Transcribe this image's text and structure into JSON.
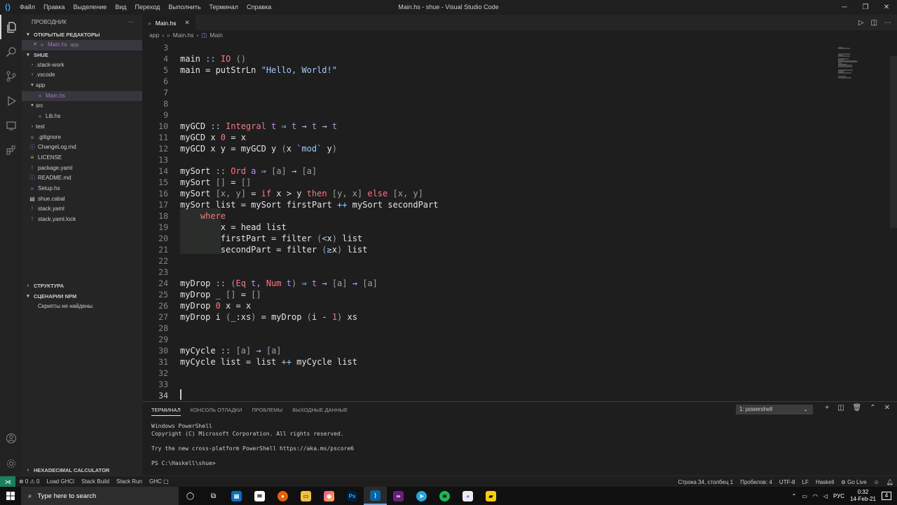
{
  "window": {
    "title": "Main.hs - shue - Visual Studio Code",
    "menu": [
      "Файл",
      "Правка",
      "Выделение",
      "Вид",
      "Переход",
      "Выполнить",
      "Терминал",
      "Справка"
    ]
  },
  "sidebar": {
    "title": "ПРОВОДНИК",
    "more": "···",
    "open_editors_header": "ОТКРЫТЫЕ РЕДАКТОРЫ",
    "open_editor": {
      "name": "Main.hs",
      "path": "app"
    },
    "project_header": "SHUE",
    "tree": [
      {
        "label": ".stack-work",
        "kind": "folder",
        "depth": 1,
        "expanded": false
      },
      {
        "label": ".vscode",
        "kind": "folder",
        "depth": 1,
        "expanded": false
      },
      {
        "label": "app",
        "kind": "folder",
        "depth": 1,
        "expanded": true
      },
      {
        "label": "Main.hs",
        "kind": "hs",
        "depth": 2
      },
      {
        "label": "src",
        "kind": "folder",
        "depth": 1,
        "expanded": true
      },
      {
        "label": "Lib.hs",
        "kind": "hs",
        "depth": 2
      },
      {
        "label": "test",
        "kind": "folder",
        "depth": 1,
        "expanded": false
      },
      {
        "label": ".gitignore",
        "kind": "git",
        "depth": 1
      },
      {
        "label": "ChangeLog.md",
        "kind": "md",
        "depth": 1
      },
      {
        "label": "LICENSE",
        "kind": "lic",
        "depth": 1
      },
      {
        "label": "package.yaml",
        "kind": "yml",
        "depth": 1
      },
      {
        "label": "README.md",
        "kind": "md",
        "depth": 1
      },
      {
        "label": "Setup.hs",
        "kind": "hs",
        "depth": 1
      },
      {
        "label": "shue.cabal",
        "kind": "cabal",
        "depth": 1
      },
      {
        "label": "stack.yaml",
        "kind": "yml",
        "depth": 1
      },
      {
        "label": "stack.yaml.lock",
        "kind": "yml",
        "depth": 1
      }
    ],
    "outline_header": "СТРУКТУРА",
    "npm_header": "СЦЕНАРИИ NPM",
    "npm_empty": "Скрипты не найдены.",
    "hex_header": "HEXADECIMAL CALCULATOR"
  },
  "tab": {
    "label": "Main.hs",
    "close": "✕"
  },
  "breadcrumb": [
    "app",
    "Main.hs",
    "Main"
  ],
  "editor": {
    "cursor_line": 34,
    "lines": [
      {
        "n": "3",
        "tokens": []
      },
      {
        "n": "4",
        "tokens": [
          [
            "fn",
            "main"
          ],
          [
            "opg",
            " :: "
          ],
          [
            "ty",
            "IO"
          ],
          [
            "brk",
            " ()"
          ]
        ]
      },
      {
        "n": "5",
        "tokens": [
          [
            "fn",
            "main = putStrLn "
          ],
          [
            "str",
            "\"Hello, World!\""
          ]
        ]
      },
      {
        "n": "6",
        "tokens": []
      },
      {
        "n": "7",
        "tokens": []
      },
      {
        "n": "8",
        "tokens": []
      },
      {
        "n": "9",
        "tokens": []
      },
      {
        "n": "10",
        "tokens": [
          [
            "fn",
            "myGCD"
          ],
          [
            "opg",
            " :: "
          ],
          [
            "ty",
            "Integral"
          ],
          [
            "tv",
            " t "
          ],
          [
            "opg",
            "⇒"
          ],
          [
            "tv",
            " t "
          ],
          [
            "opg",
            "→"
          ],
          [
            "tv",
            " t "
          ],
          [
            "opg",
            "→"
          ],
          [
            "tv",
            " t"
          ]
        ]
      },
      {
        "n": "11",
        "tokens": [
          [
            "fn",
            "myGCD x "
          ],
          [
            "num",
            "0"
          ],
          [
            "fn",
            " = x"
          ]
        ]
      },
      {
        "n": "12",
        "tokens": [
          [
            "fn",
            "myGCD x y = myGCD y "
          ],
          [
            "brk",
            "("
          ],
          [
            "fn",
            "x "
          ],
          [
            "str",
            "`mod`"
          ],
          [
            "fn",
            " y"
          ],
          [
            "brk",
            ")"
          ]
        ]
      },
      {
        "n": "13",
        "tokens": []
      },
      {
        "n": "14",
        "tokens": [
          [
            "fn",
            "mySort"
          ],
          [
            "opg",
            " :: "
          ],
          [
            "ty",
            "Ord"
          ],
          [
            "tv",
            " a "
          ],
          [
            "opg",
            "⇒"
          ],
          [
            "brk",
            " [a] "
          ],
          [
            "opg",
            "→"
          ],
          [
            "brk",
            " [a]"
          ]
        ]
      },
      {
        "n": "15",
        "tokens": [
          [
            "fn",
            "mySort "
          ],
          [
            "brk",
            "[]"
          ],
          [
            "fn",
            " = "
          ],
          [
            "brk",
            "[]"
          ]
        ]
      },
      {
        "n": "16",
        "tokens": [
          [
            "fn",
            "mySort "
          ],
          [
            "brk",
            "[x, y]"
          ],
          [
            "fn",
            " = "
          ],
          [
            "kw",
            "if"
          ],
          [
            "fn",
            " x > y "
          ],
          [
            "kw",
            "then"
          ],
          [
            "brk",
            " [y, x] "
          ],
          [
            "kw",
            "else"
          ],
          [
            "brk",
            " [x, y]"
          ]
        ]
      },
      {
        "n": "17",
        "tokens": [
          [
            "fn",
            "mySort list = mySort firstPart "
          ],
          [
            "opg",
            "++"
          ],
          [
            "fn",
            " mySort secondPart"
          ]
        ]
      },
      {
        "n": "18",
        "tokens": [
          [
            "fn",
            "    "
          ],
          [
            "kw",
            "where"
          ]
        ]
      },
      {
        "n": "19",
        "tokens": [
          [
            "fn",
            "        x = head list"
          ]
        ]
      },
      {
        "n": "20",
        "tokens": [
          [
            "fn",
            "        firstPart = filter "
          ],
          [
            "brk",
            "("
          ],
          [
            "opg",
            "<"
          ],
          [
            "fn",
            "x"
          ],
          [
            "brk",
            ")"
          ],
          [
            "fn",
            " list"
          ]
        ]
      },
      {
        "n": "21",
        "tokens": [
          [
            "fn",
            "        secondPart = filter "
          ],
          [
            "brk",
            "("
          ],
          [
            "opg",
            "≥"
          ],
          [
            "fn",
            "x"
          ],
          [
            "brk",
            ")"
          ],
          [
            "fn",
            " list"
          ]
        ]
      },
      {
        "n": "22",
        "tokens": []
      },
      {
        "n": "23",
        "tokens": []
      },
      {
        "n": "24",
        "tokens": [
          [
            "fn",
            "myDrop"
          ],
          [
            "opg",
            " :: "
          ],
          [
            "brk",
            "("
          ],
          [
            "ty",
            "Eq"
          ],
          [
            "tv",
            " t, "
          ],
          [
            "ty",
            "Num"
          ],
          [
            "tv",
            " t"
          ],
          [
            "brk",
            ")"
          ],
          [
            "opg",
            " ⇒"
          ],
          [
            "tv",
            " t "
          ],
          [
            "opg",
            "→"
          ],
          [
            "brk",
            " [a] "
          ],
          [
            "opg",
            "→"
          ],
          [
            "brk",
            " [a]"
          ]
        ]
      },
      {
        "n": "25",
        "tokens": [
          [
            "fn",
            "myDrop _ "
          ],
          [
            "brk",
            "[]"
          ],
          [
            "fn",
            " = "
          ],
          [
            "brk",
            "[]"
          ]
        ]
      },
      {
        "n": "26",
        "tokens": [
          [
            "fn",
            "myDrop "
          ],
          [
            "num",
            "0"
          ],
          [
            "fn",
            " x = x"
          ]
        ]
      },
      {
        "n": "27",
        "tokens": [
          [
            "fn",
            "myDrop i "
          ],
          [
            "brk",
            "("
          ],
          [
            "fn",
            "_:xs"
          ],
          [
            "brk",
            ")"
          ],
          [
            "fn",
            " = myDrop "
          ],
          [
            "brk",
            "("
          ],
          [
            "fn",
            "i - "
          ],
          [
            "num",
            "1"
          ],
          [
            "brk",
            ")"
          ],
          [
            "fn",
            " xs"
          ]
        ]
      },
      {
        "n": "28",
        "tokens": []
      },
      {
        "n": "29",
        "tokens": []
      },
      {
        "n": "30",
        "tokens": [
          [
            "fn",
            "myCycle"
          ],
          [
            "opg",
            " :: "
          ],
          [
            "brk",
            "[a] "
          ],
          [
            "opg",
            "→"
          ],
          [
            "brk",
            " [a]"
          ]
        ]
      },
      {
        "n": "31",
        "tokens": [
          [
            "fn",
            "myCycle list = list "
          ],
          [
            "opg",
            "++"
          ],
          [
            "fn",
            " myCycle list"
          ]
        ]
      },
      {
        "n": "32",
        "tokens": []
      },
      {
        "n": "33",
        "tokens": []
      },
      {
        "n": "34",
        "tokens": []
      }
    ]
  },
  "panel": {
    "tabs": [
      "ТЕРМИНАЛ",
      "КОНСОЛЬ ОТЛАДКИ",
      "ПРОБЛЕМЫ",
      "ВЫХОДНЫЕ ДАННЫЕ"
    ],
    "terminal_select": "1: powershell",
    "terminal_text": "Windows PowerShell\nCopyright (C) Microsoft Corporation. All rights reserved.\n\nTry the new cross-platform PowerShell https://aka.ms/pscore6\n\nPS C:\\Haskell\\shue>"
  },
  "statusbar": {
    "problems": "⊗ 0  ⚠ 0",
    "left": [
      "Load GHCi",
      "Stack Build",
      "Stack Run",
      "GHC ▢"
    ],
    "right": [
      "Строка 34, столбец 1",
      "Пробелов: 4",
      "UTF-8",
      "LF",
      "Haskell",
      "⊚ Go Live"
    ]
  },
  "taskbar": {
    "search_placeholder": "Type here to search",
    "lang": "РУС",
    "time": "0:32",
    "date": "14-Feb-21",
    "notifications": "4"
  },
  "colors": {
    "accent": "#007acc",
    "remote": "#16825d",
    "keyword": "#f97583",
    "string": "#9ecbff"
  }
}
